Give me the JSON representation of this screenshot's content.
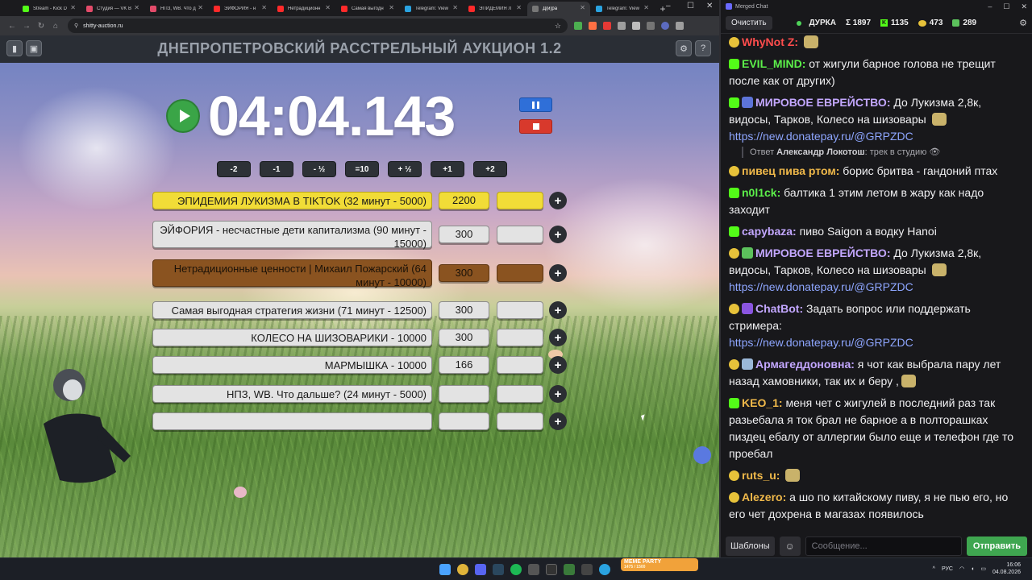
{
  "browser": {
    "tabs": [
      {
        "title": "Stream - Kick D",
        "color": "#53fc18"
      },
      {
        "title": "Студия — VK В",
        "color": "#e34b6a"
      },
      {
        "title": "НПЗ, WB. Что д",
        "color": "#e34b6a"
      },
      {
        "title": "ЭЙФОРИЯ - н",
        "color": "#ff2a2a"
      },
      {
        "title": "Нетрадиционн",
        "color": "#ff2a2a"
      },
      {
        "title": "Самая выгодн",
        "color": "#ff2a2a"
      },
      {
        "title": "Telegram: View",
        "color": "#2aa3e0"
      },
      {
        "title": "ЭПИДЕМИЯ Л",
        "color": "#ff2a2a"
      },
      {
        "title": "Д(и)ра",
        "color": "#777777"
      },
      {
        "title": "Telegram: View",
        "color": "#2aa3e0"
      }
    ],
    "url": "shitty-auction.ru"
  },
  "page": {
    "title": "ДНЕПРОПЕТРОВСКИЙ РАССТРЕЛЬНЫЙ АУКЦИОН 1.2",
    "timer": "04:04.143",
    "adjust_buttons": [
      "-2",
      "-1",
      "- ½",
      "=10",
      "+ ½",
      "+1",
      "+2"
    ],
    "lots": [
      {
        "name": "ЭПИДЕМИЯ ЛУКИЗМА В TIKTOK (32 минут - 5000)",
        "amount": "2200",
        "style": "yellow"
      },
      {
        "name": "ЭЙФОРИЯ - несчастные дети капитализма (90 минут - 15000)",
        "amount": "300",
        "style": "default"
      },
      {
        "name": "Нетрадиционные ценности | Михаил Пожарский (64 минут - 10000)",
        "amount": "300",
        "style": "brown"
      },
      {
        "name": "Самая выгодная стратегия жизни (71 минут - 12500)",
        "amount": "300",
        "style": "default"
      },
      {
        "name": "КОЛЕСО НА ШИЗОВАРИКИ - 10000",
        "amount": "300",
        "style": "default"
      },
      {
        "name": "МАРМЫШКА - 10000",
        "amount": "166",
        "style": "default"
      },
      {
        "name": "НПЗ, WB. Что дальше? (24 минут - 5000)",
        "amount": "",
        "style": "default"
      },
      {
        "name": "",
        "amount": "",
        "style": "default"
      }
    ]
  },
  "chat": {
    "window_title": "Merged Chat",
    "clear_label": "Очистить",
    "channel": "ДУРКА",
    "stats": {
      "total": "Σ 1897",
      "kick": "1135",
      "other": "473",
      "third": "289"
    },
    "messages": [
      {
        "platform": "bee",
        "user": "WhyNot Z",
        "user_color": "#ff4d4d",
        "parts": [
          {
            "t": ""
          }
        ],
        "emote": true
      },
      {
        "platform": "kick",
        "user": "EVIL_MIND",
        "user_color": "#5cf04a",
        "parts": [
          {
            "t": "от жигули барное голова не трещит после как от других)"
          }
        ]
      },
      {
        "platform": "kick",
        "badge": "#5d74d8",
        "user": "МИРОВОЕ ЕВРЕЙСТВО",
        "user_color": "#c3a7ff",
        "parts": [
          {
            "t": "До Лукизма 2,8к, видосы, Тарков, Колесо на шизовары "
          },
          {
            "emote": true
          },
          {
            "link": "https://new.donatepay.ru/@GRPZDC"
          }
        ]
      },
      {
        "reply": true,
        "label": "Ответ",
        "user": "Александр Локотош",
        "text": "трек в студию 👁"
      },
      {
        "platform": "bee",
        "user": "пивец пива ртом",
        "user_color": "#f0b94a",
        "parts": [
          {
            "t": "борис бритва - гандоний птах"
          }
        ]
      },
      {
        "platform": "kick",
        "user": "n0l1ck",
        "user_color": "#5cf04a",
        "parts": [
          {
            "t": "балтика 1 этим летом в жару как надо заходит"
          }
        ]
      },
      {
        "platform": "kick",
        "user": "capybaza",
        "user_color": "#c3a7ff",
        "parts": [
          {
            "t": "пиво Saigon а водку Hanoi"
          }
        ]
      },
      {
        "platform": "bee",
        "badge": "#5cc25c",
        "user": "МИРОВОЕ ЕВРЕЙСТВО",
        "user_color": "#c3a7ff",
        "parts": [
          {
            "t": "До Лукизма 2,8к, видосы, Тарков, Колесо на шизовары "
          },
          {
            "emote": true
          },
          {
            "link": "https://new.donatepay.ru/@GRPZDC"
          }
        ]
      },
      {
        "platform": "bee",
        "badge": "#8a55e0",
        "user": "ChatBot",
        "user_color": "#c3a7ff",
        "parts": [
          {
            "t": "Задать вопрос или поддержать стримера: "
          },
          {
            "link": "https://new.donatepay.ru/@GRPZDC"
          }
        ]
      },
      {
        "platform": "bee",
        "badge": "#9bb8d8",
        "user": "Армагеддоновна",
        "user_color": "#c3a7ff",
        "parts": [
          {
            "t": "я чот как выбрала пару лет назад хамовники, так их и беру ,"
          },
          {
            "emote": true
          }
        ]
      },
      {
        "platform": "kick",
        "user": "KEO_1",
        "user_color": "#f0b94a",
        "parts": [
          {
            "t": "меня чет с жигулей в последний раз так разьебала я ток брал не барное а в полторашках пиздец ебалу от аллергии было еще и телефон где то проебал"
          }
        ]
      },
      {
        "platform": "bee",
        "user": "ruts_u",
        "user_color": "#f0b94a",
        "parts": [
          {
            "emote": true
          }
        ]
      },
      {
        "platform": "bee",
        "user": "Alezero",
        "user_color": "#f0b94a",
        "parts": [
          {
            "t": "а шо по китайскому пиву, я не пью его, но его чет дохрена в магазах появилось"
          }
        ]
      }
    ],
    "templates_label": "Шаблоны",
    "input_placeholder": "Сообщение...",
    "send_label": "Отправить"
  },
  "taskbar": {
    "meme_title": "MEME PARTY",
    "meme_sub": "1475 / 1500",
    "lang": "РУС",
    "time": "16:06",
    "date": "04.08.2026"
  }
}
